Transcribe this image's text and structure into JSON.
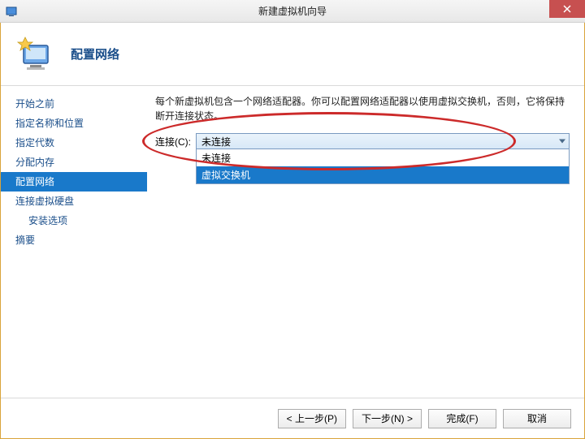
{
  "titlebar": {
    "title": "新建虚拟机向导"
  },
  "header": {
    "title": "配置网络"
  },
  "sidebar": {
    "items": [
      {
        "label": "开始之前",
        "active": false,
        "sub": false
      },
      {
        "label": "指定名称和位置",
        "active": false,
        "sub": false
      },
      {
        "label": "指定代数",
        "active": false,
        "sub": false
      },
      {
        "label": "分配内存",
        "active": false,
        "sub": false
      },
      {
        "label": "配置网络",
        "active": true,
        "sub": false
      },
      {
        "label": "连接虚拟硬盘",
        "active": false,
        "sub": false
      },
      {
        "label": "安装选项",
        "active": false,
        "sub": true
      },
      {
        "label": "摘要",
        "active": false,
        "sub": false
      }
    ]
  },
  "content": {
    "description": "每个新虚拟机包含一个网络适配器。你可以配置网络适配器以使用虚拟交换机，否则，它将保持断开连接状态。",
    "conn_label": "连接(C):",
    "selected": "未连接",
    "options": [
      {
        "label": "未连接",
        "highlight": false
      },
      {
        "label": "虚拟交换机",
        "highlight": true
      }
    ]
  },
  "footer": {
    "prev": "< 上一步(P)",
    "next": "下一步(N) >",
    "finish": "完成(F)",
    "cancel": "取消"
  },
  "chart_data": null
}
